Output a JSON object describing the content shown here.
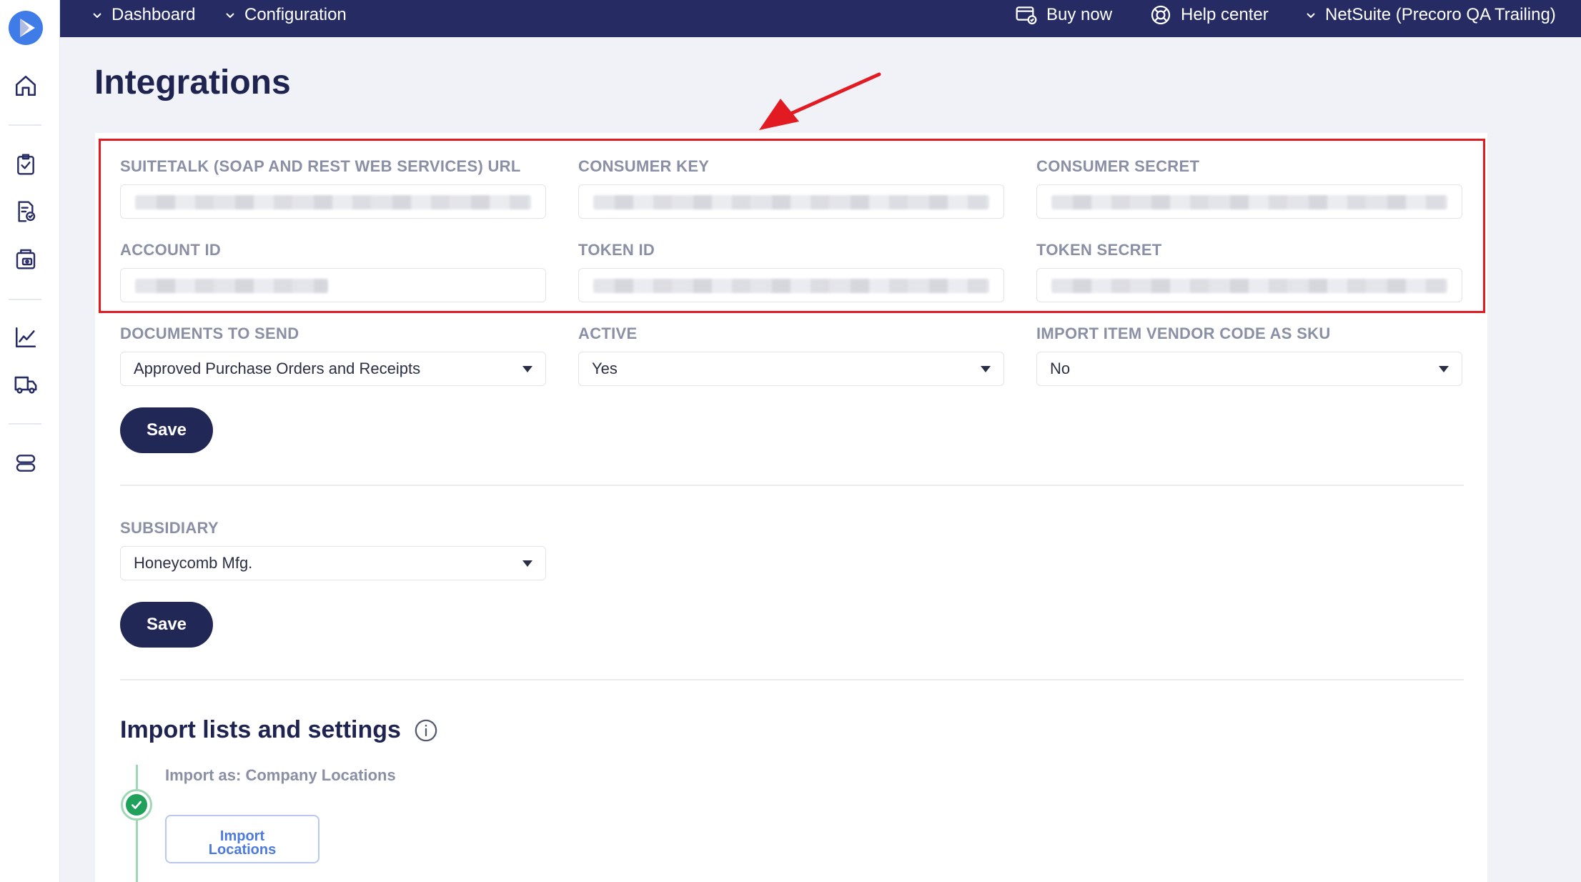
{
  "topbar": {
    "dashboard": "Dashboard",
    "configuration": "Configuration",
    "buy_now": "Buy now",
    "help_center": "Help center",
    "account": "NetSuite (Precoro QA Trailing)"
  },
  "sidebar": {
    "icons": [
      "home-icon",
      "clipboard-check-icon",
      "document-check-icon",
      "receipt-icon",
      "chart-line-icon",
      "truck-icon",
      "server-icon"
    ]
  },
  "page": {
    "title": "Integrations"
  },
  "credentials": {
    "suitetalk_url_label": "SUITETALK (SOAP AND REST WEB SERVICES) URL",
    "consumer_key_label": "CONSUMER KEY",
    "consumer_secret_label": "CONSUMER SECRET",
    "account_id_label": "ACCOUNT ID",
    "token_id_label": "TOKEN ID",
    "token_secret_label": "TOKEN SECRET"
  },
  "options": {
    "documents_label": "DOCUMENTS TO SEND",
    "documents_value": "Approved Purchase Orders and Receipts",
    "active_label": "ACTIVE",
    "active_value": "Yes",
    "vendor_code_label": "IMPORT ITEM VENDOR CODE AS SKU",
    "vendor_code_value": "No",
    "save_label": "Save"
  },
  "subsidiary": {
    "label": "SUBSIDIARY",
    "value": "Honeycomb Mfg.",
    "save_label": "Save"
  },
  "import": {
    "title": "Import lists and settings",
    "step_label": "Import as: Company Locations",
    "button_line1": "Import",
    "button_line2": "Locations"
  },
  "colors": {
    "topbar": "#262c63",
    "primary_button": "#212855",
    "annotation": "#e21b23",
    "success": "#1fa05b",
    "link": "#4d7ae0"
  }
}
